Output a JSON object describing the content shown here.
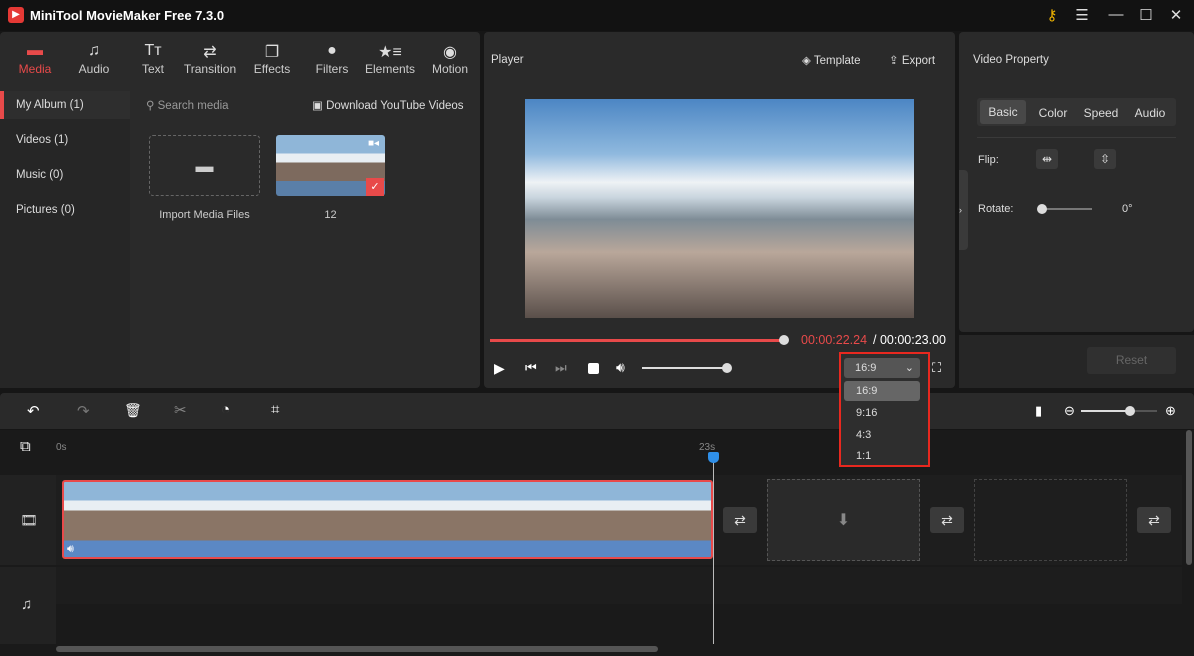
{
  "app": {
    "title": "MiniTool MovieMaker Free 7.3.0"
  },
  "toolbar": {
    "items": [
      {
        "label": "Media",
        "icon": "folder-icon"
      },
      {
        "label": "Audio",
        "icon": "music-icon"
      },
      {
        "label": "Text",
        "icon": "text-icon"
      },
      {
        "label": "Transition",
        "icon": "transition-icon"
      },
      {
        "label": "Effects",
        "icon": "effects-icon"
      },
      {
        "label": "Filters",
        "icon": "filters-icon"
      },
      {
        "label": "Elements",
        "icon": "elements-icon"
      },
      {
        "label": "Motion",
        "icon": "motion-icon"
      }
    ]
  },
  "sidebar": {
    "items": [
      {
        "label": "My Album (1)"
      },
      {
        "label": "Videos (1)"
      },
      {
        "label": "Music (0)"
      },
      {
        "label": "Pictures (0)"
      }
    ]
  },
  "media": {
    "search_placeholder": "Search media",
    "download_label": "Download YouTube Videos",
    "import_label": "Import Media Files",
    "clip_label": "12"
  },
  "player": {
    "title": "Player",
    "template_label": "Template",
    "export_label": "Export",
    "current_time": "00:00:22.24",
    "total_time": "/ 00:00:23.00",
    "progress": 0.98,
    "volume": 0.95,
    "aspect": {
      "selected": "16:9",
      "options": [
        "16:9",
        "9:16",
        "4:3",
        "1:1"
      ]
    }
  },
  "property": {
    "title": "Video Property",
    "tabs": [
      "Basic",
      "Color",
      "Speed",
      "Audio"
    ],
    "flip_label": "Flip:",
    "rotate_label": "Rotate:",
    "rotate_value": "0°",
    "reset_label": "Reset"
  },
  "timeline": {
    "ruler_start": "0s",
    "ruler_mark": "23s",
    "zoom": 0.8
  },
  "colors": {
    "accent": "#e84a4a",
    "playhead": "#2f8fe8"
  }
}
